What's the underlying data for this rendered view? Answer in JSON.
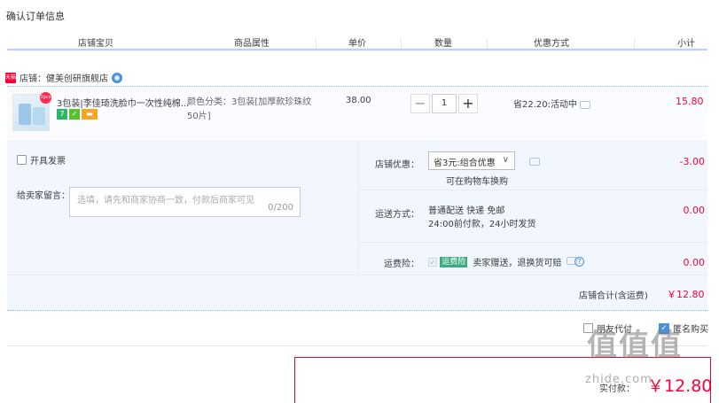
{
  "page": {
    "title": "确认订单信息"
  },
  "columns": [
    "店铺宝贝",
    "商品属性",
    "单价",
    "数量",
    "优惠方式",
    "小计"
  ],
  "shop": {
    "badge": "天猫",
    "label": "店铺：健美创研旗舰店",
    "ww_icon": "wangwang-chat-icon"
  },
  "item": {
    "title": "3包装|李佳琦洗脸巾一次性纯棉...",
    "thumb_badge": "2pcs",
    "tags": [
      {
        "icon": "seven-day-return-icon",
        "text": "7",
        "color": "#2db66a"
      },
      {
        "icon": "guarantee-icon",
        "text": "✓",
        "color": "#58c22c"
      },
      {
        "icon": "card-icon",
        "text": "▬",
        "color": "#f5a623"
      }
    ],
    "attr": "颜色分类：3包装[加厚款珍珠纹50片]",
    "price": "38.00",
    "qty": "1",
    "qty_minus": "−",
    "qty_plus": "+",
    "promo": "省22.20:活动中",
    "subtotal": "15.80"
  },
  "invoice": {
    "label": "开具发票",
    "checked": false
  },
  "memo": {
    "label": "给卖家留言：",
    "placeholder": "选填，请先和商家协商一致，付款后商家可见",
    "count": "0/200"
  },
  "shop_discount": {
    "label": "店铺优惠：",
    "selected": "省3元:组合优惠",
    "hint": "可在购物车换购",
    "value": "-3.00"
  },
  "shipping": {
    "label": "运送方式：",
    "line1": "普通配送 快递 免邮",
    "line2": "24:00前付款，24小时发货",
    "value": "0.00"
  },
  "insurance": {
    "label": "运费险：",
    "tag": "运费险",
    "text": "卖家赠送，退换货可赔",
    "value": "0.00"
  },
  "shop_total": {
    "label": "店铺合计(含运费)",
    "value": "￥12.80"
  },
  "options": {
    "friend_pay": "朋友代付",
    "anonymous": "匿名购买",
    "anonymous_checked": true
  },
  "pay": {
    "label": "实付款：",
    "value": "￥12.80"
  },
  "watermark": {
    "brand": "值值值",
    "url": "zhide.com"
  },
  "colors": {
    "accent": "#ff0036",
    "panel_bg": "#f2f7ff",
    "header_line": "#b2d1ff",
    "check_blue": "#4a90e2"
  }
}
